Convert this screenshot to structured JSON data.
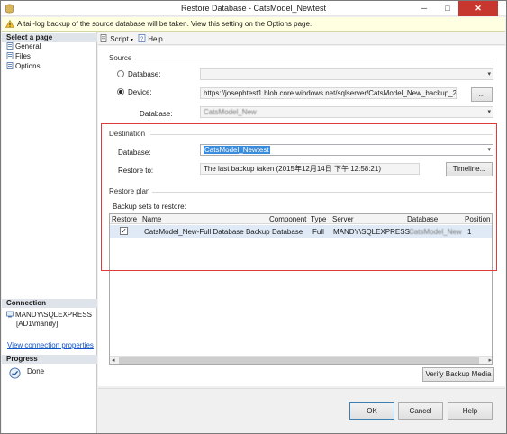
{
  "window": {
    "title": "Restore Database - CatsModel_Newtest",
    "minimize_glyph": "─",
    "maximize_glyph": "□",
    "close_glyph": "✕"
  },
  "infobar": {
    "message": "A tail-log backup of the source database will be taken. View this setting on the Options page."
  },
  "left_pane": {
    "select_page_header": "Select a page",
    "pages": [
      {
        "label": "General",
        "icon": "page-icon"
      },
      {
        "label": "Files",
        "icon": "page-icon"
      },
      {
        "label": "Options",
        "icon": "page-icon"
      }
    ],
    "connection_header": "Connection",
    "connection_server": "MANDY\\SQLEXPRESS",
    "connection_user": "[AD1\\mandy]",
    "view_connection_link": "View connection properties",
    "progress_header": "Progress",
    "progress_status": "Done"
  },
  "toolbar": {
    "script_label": "Script",
    "help_label": "Help"
  },
  "source": {
    "section_label": "Source",
    "database_radio_label": "Database:",
    "device_radio_label": "Device:",
    "device_value": "https://josephtest1.blob.core.windows.net/sqlserver/CatsModel_New_backup_2015",
    "browse_label": "...",
    "database_label": "Database:",
    "database_value": "CatsModel_New",
    "selected_option": "Device"
  },
  "destination": {
    "section_label": "Destination",
    "database_label": "Database:",
    "database_value": "CatsModel_Newtest",
    "restore_to_label": "Restore to:",
    "restore_to_value": "The last backup taken (2015年12月14日 下午 12:58:21)",
    "timeline_button": "Timeline..."
  },
  "restore_plan": {
    "section_label": "Restore plan",
    "backup_sets_label": "Backup sets to restore:",
    "columns": [
      "Restore",
      "Name",
      "Component",
      "Type",
      "Server",
      "Database",
      "Position"
    ],
    "rows": [
      {
        "restore_checked": true,
        "name": "CatsModel_New-Full Database Backup",
        "component": "Database",
        "type": "Full",
        "server": "MANDY\\SQLEXPRESS",
        "database": "CatsModel_New",
        "position": "1"
      }
    ],
    "verify_button": "Verify Backup Media"
  },
  "footer": {
    "ok_label": "OK",
    "cancel_label": "Cancel",
    "help_label": "Help"
  },
  "colors": {
    "highlight_border": "#e03a3a",
    "selection": "#3a8cdc",
    "link": "#1155cc"
  }
}
